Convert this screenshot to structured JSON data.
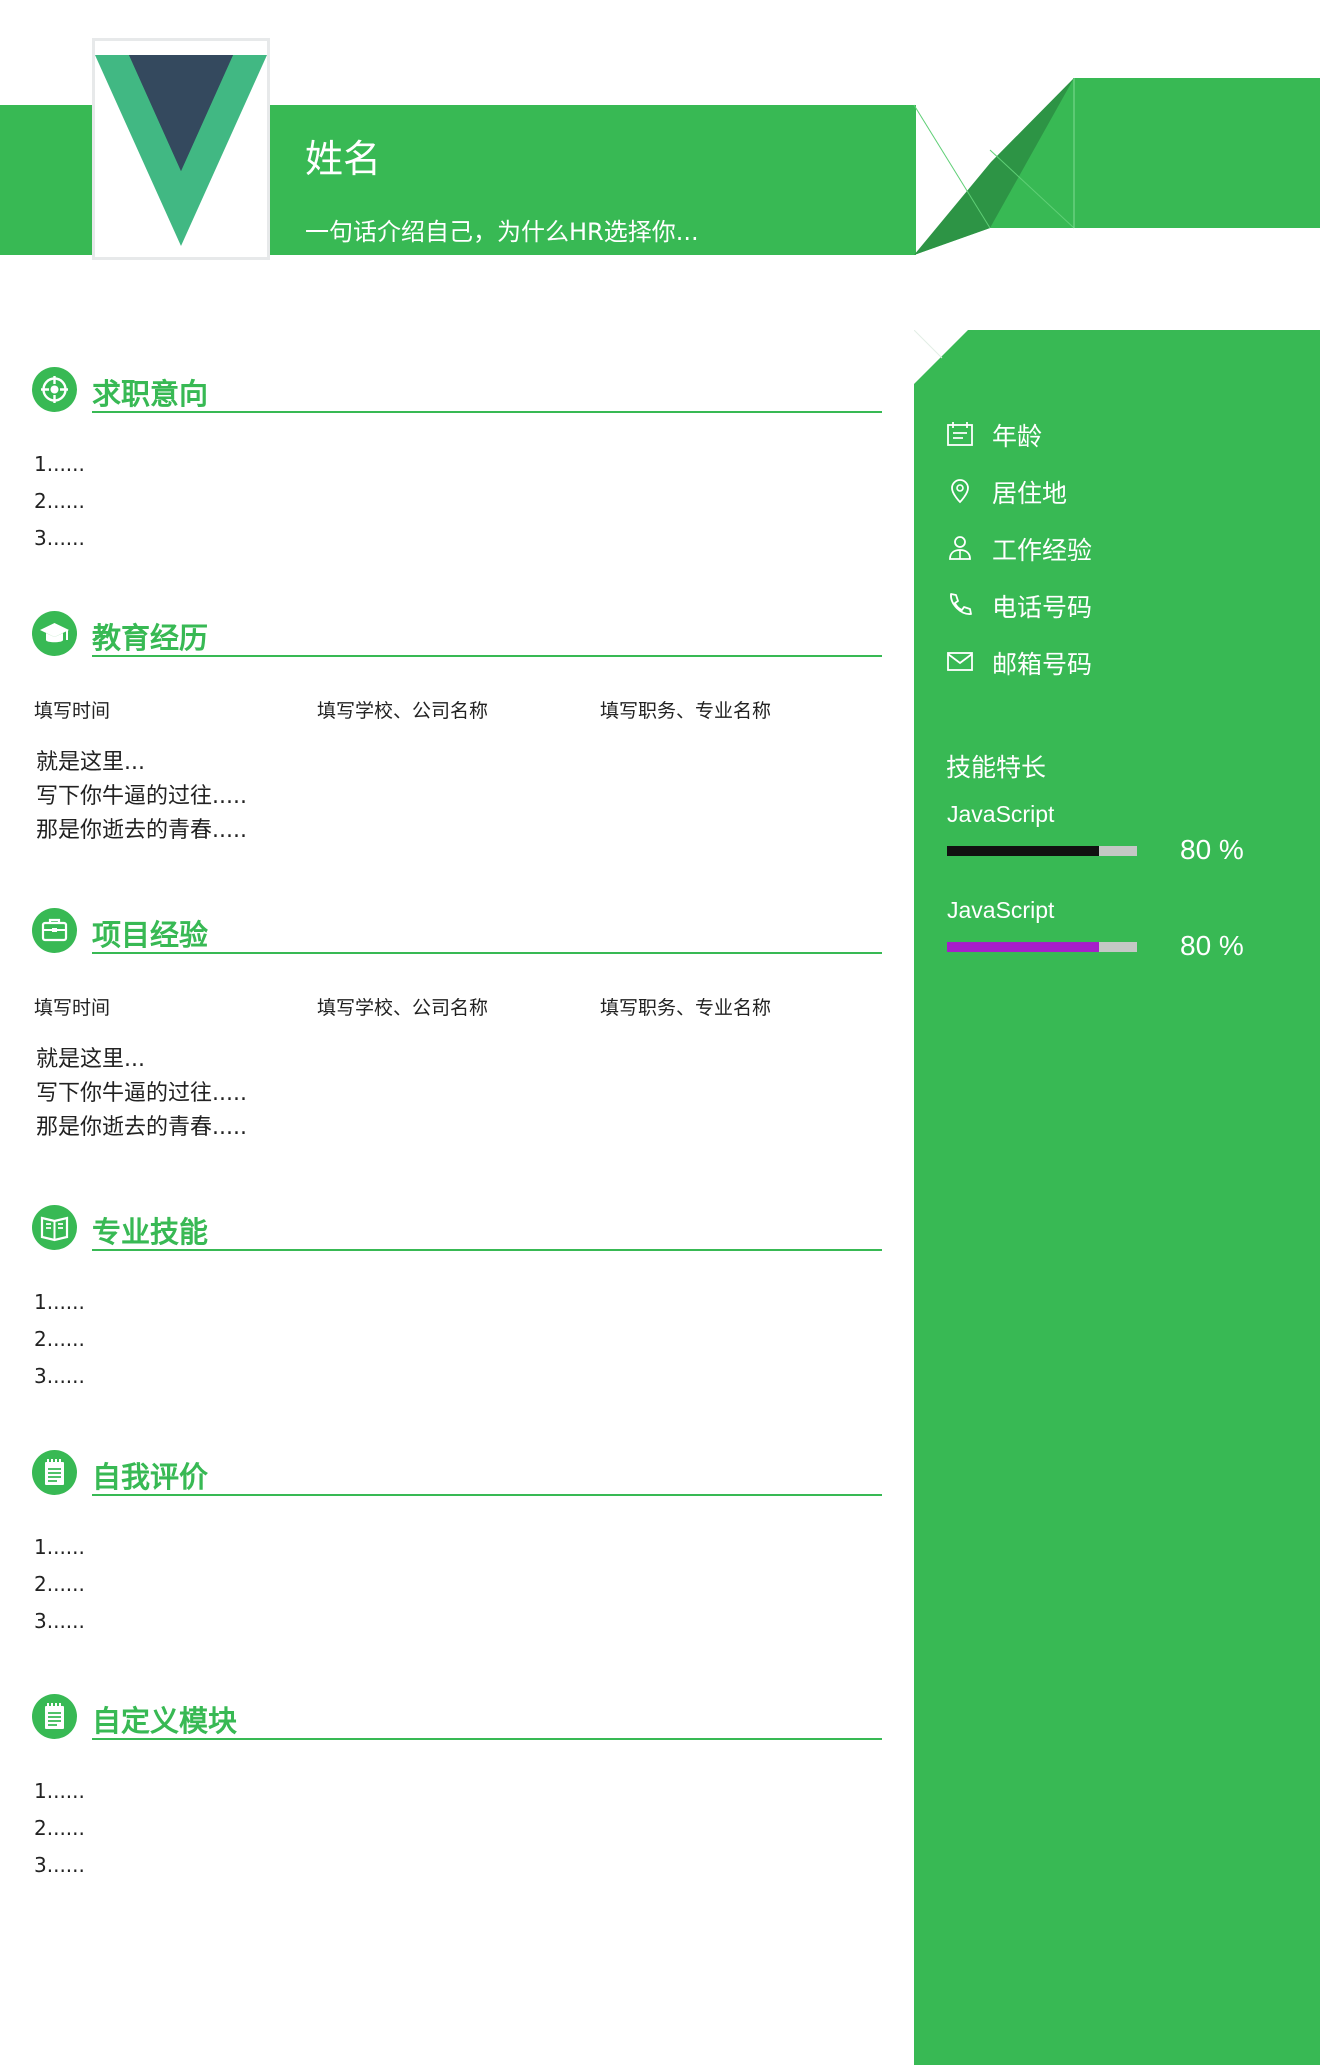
{
  "header": {
    "name": "姓名",
    "intro": "一句话介绍自己，为什么HR选择你...",
    "brand_color": "#38b954",
    "dark_accent": "#2d9445",
    "logo": "vue-logo"
  },
  "sections": {
    "intent": {
      "title": "求职意向",
      "icon": "target-icon",
      "items": [
        "1......",
        "2......",
        "3......"
      ]
    },
    "education": {
      "title": "教育经历",
      "icon": "graduation-cap-icon",
      "columns": [
        "填写时间",
        "填写学校、公司名称",
        "填写职务、专业名称"
      ],
      "lines": [
        "就是这里...",
        "写下你牛逼的过往.....",
        "那是你逝去的青春....."
      ]
    },
    "project": {
      "title": "项目经验",
      "icon": "briefcase-icon",
      "columns": [
        "填写时间",
        "填写学校、公司名称",
        "填写职务、专业名称"
      ],
      "lines": [
        "就是这里...",
        "写下你牛逼的过往.....",
        "那是你逝去的青春....."
      ]
    },
    "skills": {
      "title": "专业技能",
      "icon": "book-icon",
      "items": [
        "1......",
        "2......",
        "3......"
      ]
    },
    "self_eval": {
      "title": "自我评价",
      "icon": "notepad-icon",
      "items": [
        "1......",
        "2......",
        "3......"
      ]
    },
    "custom": {
      "title": "自定义模块",
      "icon": "notepad-icon",
      "items": [
        "1......",
        "2......",
        "3......"
      ]
    }
  },
  "sidebar": {
    "info": [
      {
        "icon": "calendar-icon",
        "label": "年龄"
      },
      {
        "icon": "location-pin-icon",
        "label": "居住地"
      },
      {
        "icon": "briefcase-people-icon",
        "label": "工作经验"
      },
      {
        "icon": "phone-icon",
        "label": "电话号码"
      },
      {
        "icon": "mail-icon",
        "label": "邮箱号码"
      }
    ],
    "skills_title": "技能特长",
    "skill_bars": [
      {
        "name": "JavaScript",
        "level": 0.8,
        "percent_text": "80 %",
        "color": "#111111"
      },
      {
        "name": "JavaScript",
        "level": 0.8,
        "percent_text": "80 %",
        "color": "#a61ec9"
      }
    ]
  }
}
